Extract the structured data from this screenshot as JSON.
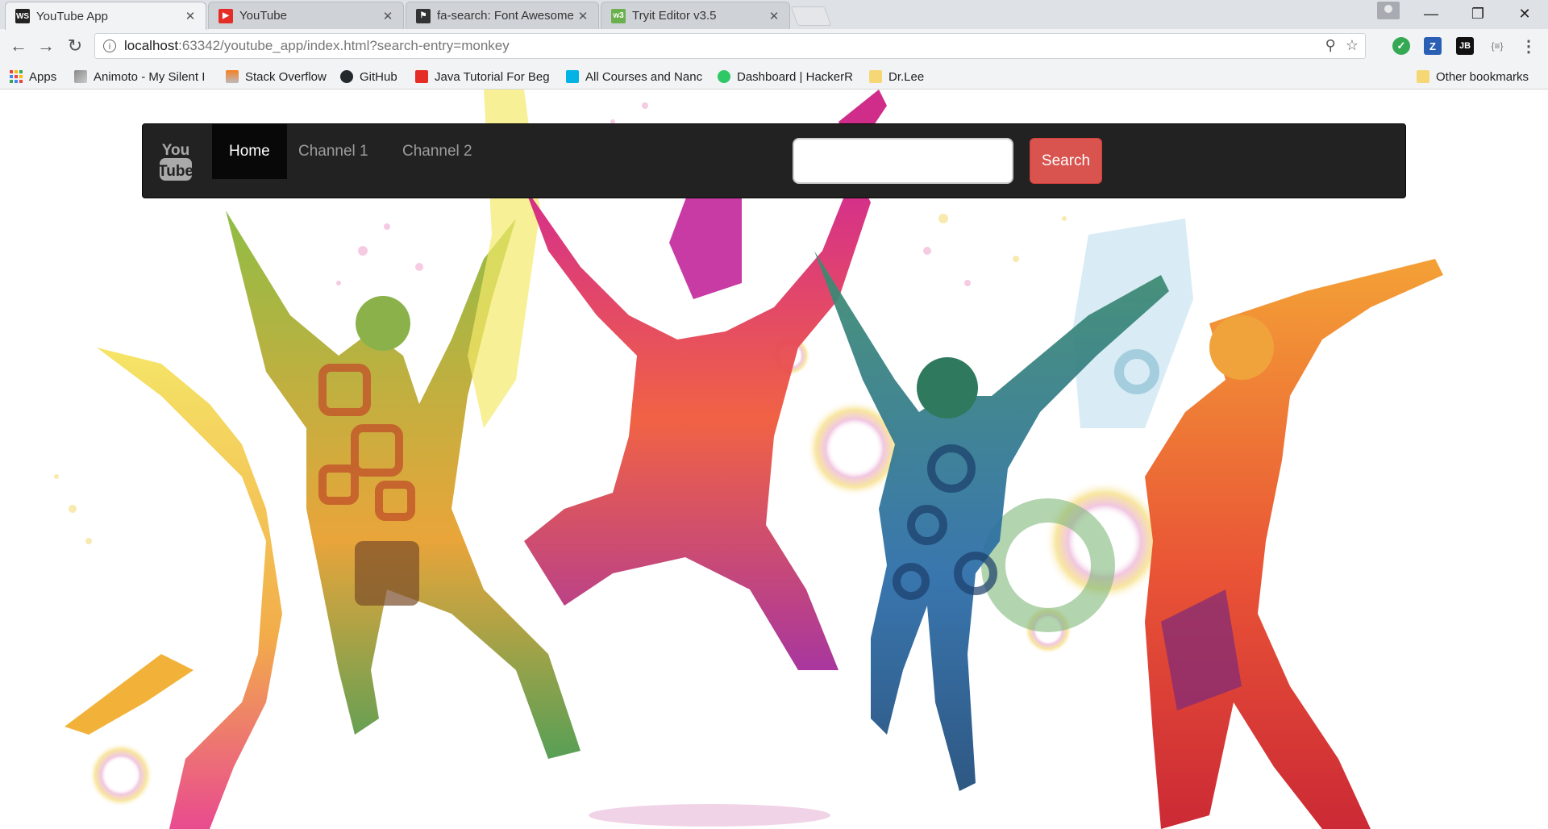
{
  "browser": {
    "tabs": [
      {
        "title": "YouTube App",
        "favicon": "webstorm-icon",
        "active": true
      },
      {
        "title": "YouTube",
        "favicon": "youtube-icon",
        "active": false
      },
      {
        "title": "fa-search: Font Awesome",
        "favicon": "flag-icon",
        "active": false
      },
      {
        "title": "Tryit Editor v3.5",
        "favicon": "w3schools-icon",
        "active": false
      }
    ],
    "tab_close_glyph": "✕",
    "address": {
      "host": "localhost",
      "path": ":63342/youtube_app/index.html?search-entry=monkey"
    },
    "bookmarks": [
      {
        "label": "Apps",
        "icon": "apps-grid-icon"
      },
      {
        "label": "Animoto - My Silent I",
        "icon": "animoto-icon"
      },
      {
        "label": "Stack Overflow",
        "icon": "stackoverflow-icon"
      },
      {
        "label": "GitHub",
        "icon": "github-icon"
      },
      {
        "label": "Java Tutorial For Beg",
        "icon": "youtube-icon"
      },
      {
        "label": "All Courses and Nanc",
        "icon": "udacity-icon"
      },
      {
        "label": "Dashboard | HackerR",
        "icon": "hackerrank-icon"
      },
      {
        "label": "Dr.Lee",
        "icon": "folder-icon"
      },
      {
        "label": "Other bookmarks",
        "icon": "folder-icon"
      }
    ],
    "extensions": [
      "check-icon",
      "z-icon",
      "jb-icon",
      "json-icon"
    ],
    "ext_labels": {
      "z": "Z",
      "jb": "JB",
      "json": "{≡}"
    }
  },
  "page": {
    "brand_logo": "YouTube",
    "brand_top": "You",
    "brand_bottom": "Tube",
    "nav": [
      {
        "label": "Home",
        "active": true
      },
      {
        "label": "Channel 1",
        "active": false
      },
      {
        "label": "Channel 2",
        "active": false
      }
    ],
    "search": {
      "value": "",
      "placeholder": "",
      "button_label": "Search"
    },
    "colors": {
      "navbar": "#222222",
      "search_button": "#d9534f",
      "active_nav": "#080808"
    }
  }
}
